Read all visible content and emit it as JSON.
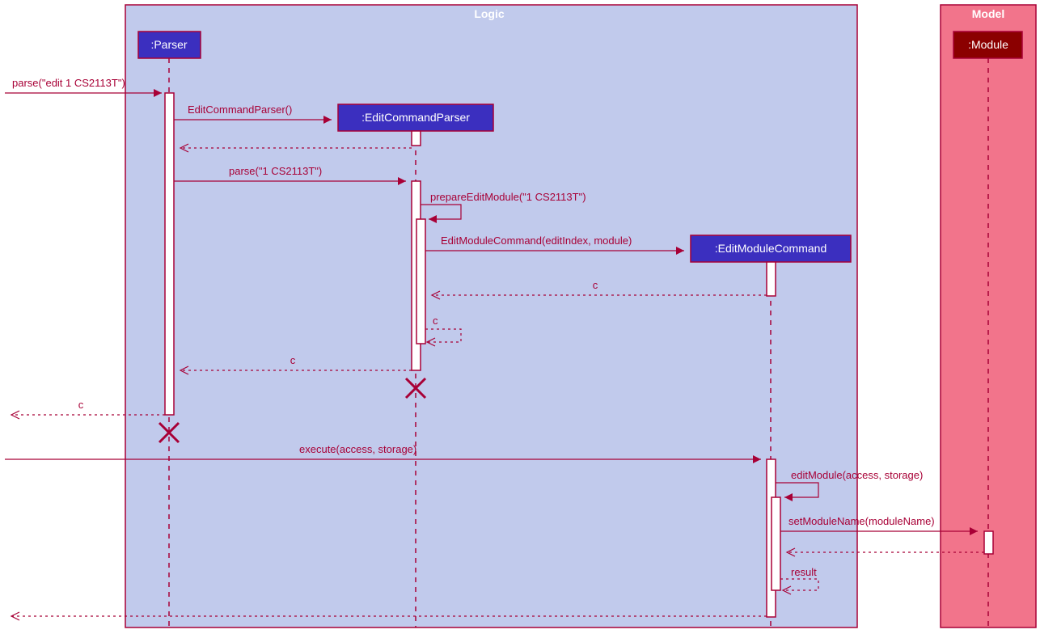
{
  "boxes": {
    "logic": {
      "title": "Logic"
    },
    "model": {
      "title": "Model"
    }
  },
  "participants": {
    "parser": ":Parser",
    "editCommandParser": ":EditCommandParser",
    "editModuleCommand": ":EditModuleCommand",
    "module": ":Module"
  },
  "messages": {
    "m1": "parse(\"edit 1 CS2113T\")",
    "m2": "EditCommandParser()",
    "m3": "parse(\"1 CS2113T\")",
    "m4": "prepareEditModule(\"1 CS2113T\")",
    "m5": "EditModuleCommand(editIndex, module)",
    "m6": "c",
    "m7": "c",
    "m8": "c",
    "m9": "c",
    "m10": "execute(access, storage)",
    "m11": "editModule(access, storage)",
    "m12": "setModuleName(moduleName)",
    "m13": "result"
  }
}
